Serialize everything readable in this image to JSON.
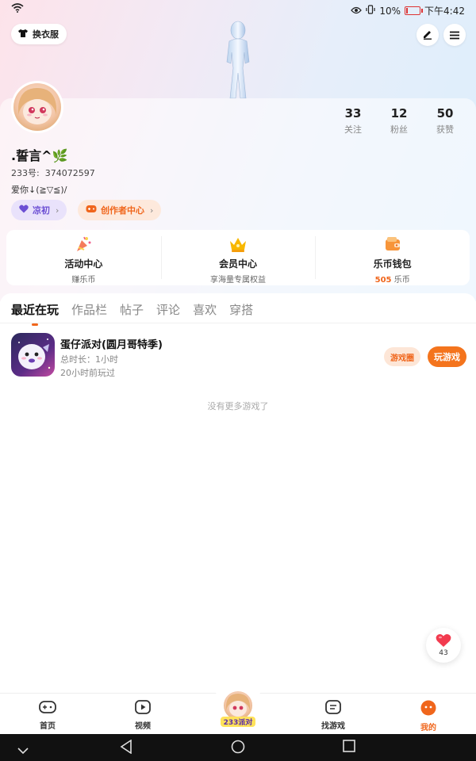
{
  "status_bar": {
    "time": "下午4:42",
    "battery": "10%",
    "battery_level": 0.1
  },
  "header": {
    "outfit_button": "换衣服",
    "edit_icon": "pen-icon",
    "menu_icon": "hamburger-menu-icon"
  },
  "profile": {
    "nickname": ".誓言^🌿",
    "uid_label": "233号:",
    "uid": "374072597",
    "signature": "爱你↓(≧▽≦)/",
    "stats": [
      {
        "value": "33",
        "label": "关注"
      },
      {
        "value": "12",
        "label": "粉丝"
      },
      {
        "value": "50",
        "label": "获赞"
      }
    ],
    "chips": [
      {
        "label": "凉初",
        "icon": "heart-icon",
        "color": "#6c4fd4"
      },
      {
        "label": "创作者中心",
        "icon": "gamepad-icon",
        "color": "#f0661c"
      }
    ]
  },
  "features": [
    {
      "title": "活动中心",
      "sub": "赚乐币",
      "icon": "party-popper-icon"
    },
    {
      "title": "会员中心",
      "sub": "享海量专属权益",
      "icon": "crown-icon"
    },
    {
      "title": "乐币钱包",
      "sub_highlight": "505",
      "sub_suffix": " 乐币",
      "icon": "wallet-icon"
    }
  ],
  "tabs": [
    {
      "label": "最近在玩",
      "active": true
    },
    {
      "label": "作品栏"
    },
    {
      "label": "帖子"
    },
    {
      "label": "评论"
    },
    {
      "label": "喜欢"
    },
    {
      "label": "穿搭"
    }
  ],
  "recent_game": {
    "name": "蛋仔派对(圆月哥特季)",
    "duration": "总时长：1小时",
    "last_played": "20小时前玩过",
    "circle_button": "游戏圈",
    "play_button": "玩游戏"
  },
  "no_more_text": "没有更多游戏了",
  "favorites": {
    "count": "43",
    "icon": "heart-icon"
  },
  "bottom_nav": [
    {
      "label": "首页",
      "icon": "gamepad-icon"
    },
    {
      "label": "视频",
      "icon": "play-video-icon"
    },
    {
      "label": "233派对",
      "icon": "party-avatar"
    },
    {
      "label": "找游戏",
      "icon": "list-search-icon"
    },
    {
      "label": "我的",
      "icon": "smiley-face-icon",
      "active": true
    }
  ],
  "colors": {
    "accent": "#f0661c",
    "purple": "#6c4fd4"
  }
}
